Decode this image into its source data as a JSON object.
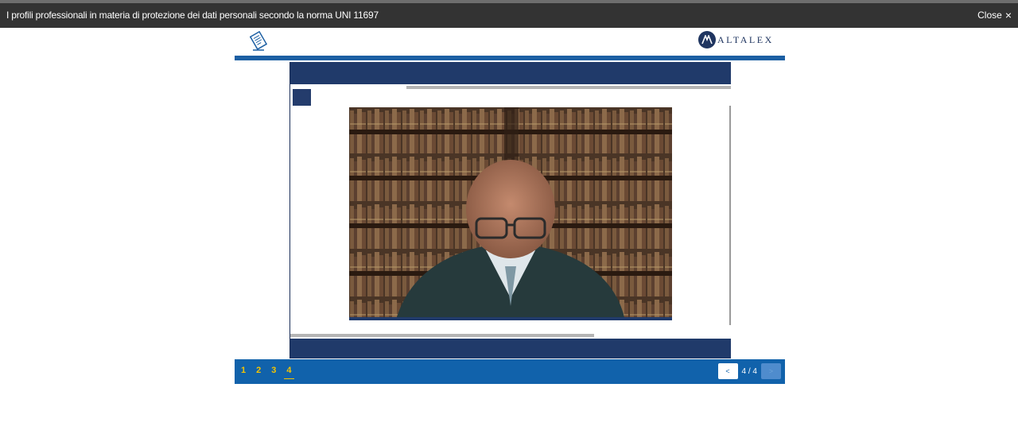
{
  "window": {
    "title": "I profili professionali in materia di protezione dei dati personali secondo la norma UNI 11697",
    "close_label": "Close",
    "close_glyph": "×"
  },
  "header": {
    "logo_text": "ALTALEX",
    "brand_color": "#1f3560",
    "accent_color": "#1c5fa3"
  },
  "icons": {
    "document": "document-edit-icon",
    "logo": "altalex-logo-icon",
    "prev": "chevron-left-icon",
    "next": "chevron-right-icon"
  },
  "navigation": {
    "pages": [
      "1",
      "2",
      "3",
      "4"
    ],
    "active_page": "4",
    "counter": "4 / 4",
    "prev_glyph": "<",
    "next_glyph": ">",
    "link_color": "#f5c400"
  }
}
